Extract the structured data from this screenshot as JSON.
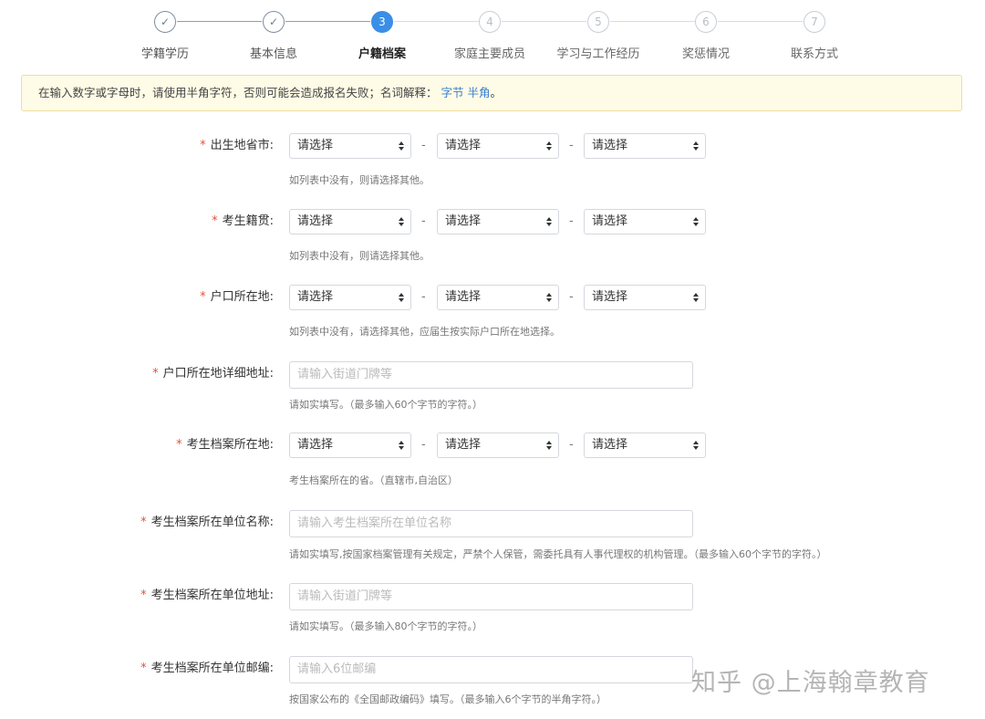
{
  "steps": [
    {
      "number": "1",
      "label": "学籍学历",
      "state": "done"
    },
    {
      "number": "2",
      "label": "基本信息",
      "state": "done"
    },
    {
      "number": "3",
      "label": "户籍档案",
      "state": "active"
    },
    {
      "number": "4",
      "label": "家庭主要成员",
      "state": "todo"
    },
    {
      "number": "5",
      "label": "学习与工作经历",
      "state": "todo"
    },
    {
      "number": "6",
      "label": "奖惩情况",
      "state": "todo"
    },
    {
      "number": "7",
      "label": "联系方式",
      "state": "todo"
    }
  ],
  "notice": {
    "text": "在输入数字或字母时，请使用半角字符，否则可能会造成报名失败；名词解释：",
    "link1": "字节",
    "link2": "半角",
    "end": "。"
  },
  "required_mark": "*",
  "select_placeholder": "请选择",
  "dash": "-",
  "fields": {
    "birthplace": {
      "label": "出生地省市:",
      "hint": "如列表中没有，则请选择其他。"
    },
    "native_place": {
      "label": "考生籍贯:",
      "hint": "如列表中没有，则请选择其他。"
    },
    "hukou": {
      "label": "户口所在地:",
      "hint": "如列表中没有，请选择其他，应届生按实际户口所在地选择。"
    },
    "hukou_address": {
      "label": "户口所在地详细地址:",
      "placeholder": "请输入街道门牌等",
      "hint": "请如实填写。（最多输入60个字节的字符。）"
    },
    "archive_place": {
      "label": "考生档案所在地:",
      "hint": "考生档案所在的省。（直辖市,自治区）"
    },
    "archive_unit_name": {
      "label": "考生档案所在单位名称:",
      "placeholder": "请输入考生档案所在单位名称",
      "hint": "请如实填写,按国家档案管理有关规定，严禁个人保管，需委托具有人事代理权的机构管理。（最多输入60个字节的字符。）"
    },
    "archive_unit_address": {
      "label": "考生档案所在单位地址:",
      "placeholder": "请输入街道门牌等",
      "hint": "请如实填写。（最多输入80个字节的字符。）"
    },
    "archive_unit_zip": {
      "label": "考生档案所在单位邮编:",
      "placeholder": "请输入6位邮编",
      "hint": "按国家公布的《全国邮政编码》填写。（最多输入6个字节的半角字符。）"
    }
  },
  "watermark": "知乎 @上海翰章教育"
}
